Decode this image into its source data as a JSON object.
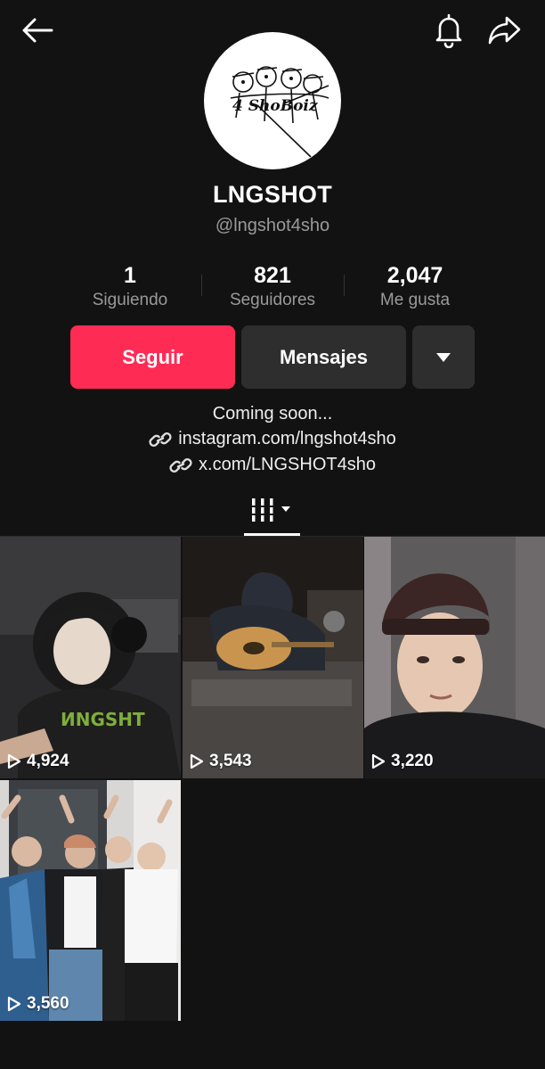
{
  "profile": {
    "name": "LNGSHOT",
    "handle": "@lngshot4sho",
    "avatar_text": "4 ShoBoiz"
  },
  "stats": [
    {
      "value": "1",
      "label": "Siguiendo"
    },
    {
      "value": "821",
      "label": "Seguidores"
    },
    {
      "value": "2,047",
      "label": "Me gusta"
    }
  ],
  "actions": {
    "follow_label": "Seguir",
    "message_label": "Mensajes"
  },
  "bio": {
    "text": "Coming soon...",
    "links": [
      "instagram.com/lngshot4sho",
      "x.com/LNGSHOT4sho"
    ]
  },
  "videos": [
    {
      "views": "4,924"
    },
    {
      "views": "3,543"
    },
    {
      "views": "3,220"
    },
    {
      "views": "3,560"
    }
  ],
  "colors": {
    "background": "#121212",
    "accent": "#fe2c55",
    "secondary_button": "#2e2e2e",
    "muted_text": "#9a9a9a"
  },
  "icons": {
    "back": "arrow-left-icon",
    "notifications": "bell-icon",
    "share": "share-arrow-icon",
    "more": "caret-down-icon",
    "link": "link-icon",
    "grid_tab": "grid-columns-icon",
    "views": "play-icon"
  }
}
